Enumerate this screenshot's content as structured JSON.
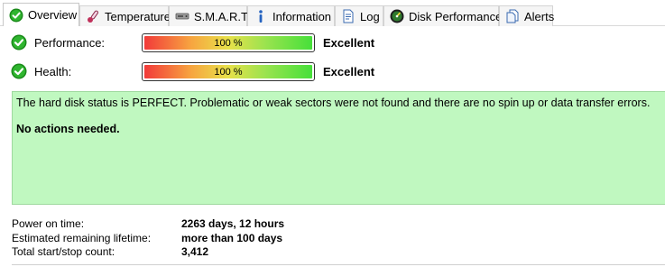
{
  "tabs": [
    {
      "label": "Overview",
      "icon": "check-circle-icon",
      "active": true
    },
    {
      "label": "Temperature",
      "icon": "thermometer-icon",
      "active": false
    },
    {
      "label": "S.M.A.R.T.",
      "icon": "disk-drive-icon",
      "active": false
    },
    {
      "label": "Information",
      "icon": "info-icon",
      "active": false
    },
    {
      "label": "Log",
      "icon": "log-document-icon",
      "active": false
    },
    {
      "label": "Disk Performance",
      "icon": "speedometer-icon",
      "active": false
    },
    {
      "label": "Alerts",
      "icon": "alerts-document-icon",
      "active": false
    }
  ],
  "metrics": {
    "performance": {
      "label": "Performance:",
      "percent_text": "100 %",
      "level": 1.0,
      "rating": "Excellent"
    },
    "health": {
      "label": "Health:",
      "percent_text": "100 %",
      "level": 1.0,
      "rating": "Excellent"
    }
  },
  "status": {
    "message": "The hard disk status is PERFECT. Problematic or weak sectors were not found and there are no spin up or data transfer errors.",
    "action": "No actions needed.",
    "background_color": "#c0f8c0"
  },
  "info": {
    "power_on": {
      "label": "Power on time:",
      "value": "2263 days, 12 hours"
    },
    "remaining": {
      "label": "Estimated remaining lifetime:",
      "value": "more than 100 days"
    },
    "startstop": {
      "label": "Total start/stop count:",
      "value": "3,412"
    }
  },
  "colors": {
    "ok_green": "#1a9a1a",
    "accent_status_bg": "#c0f8c0"
  }
}
